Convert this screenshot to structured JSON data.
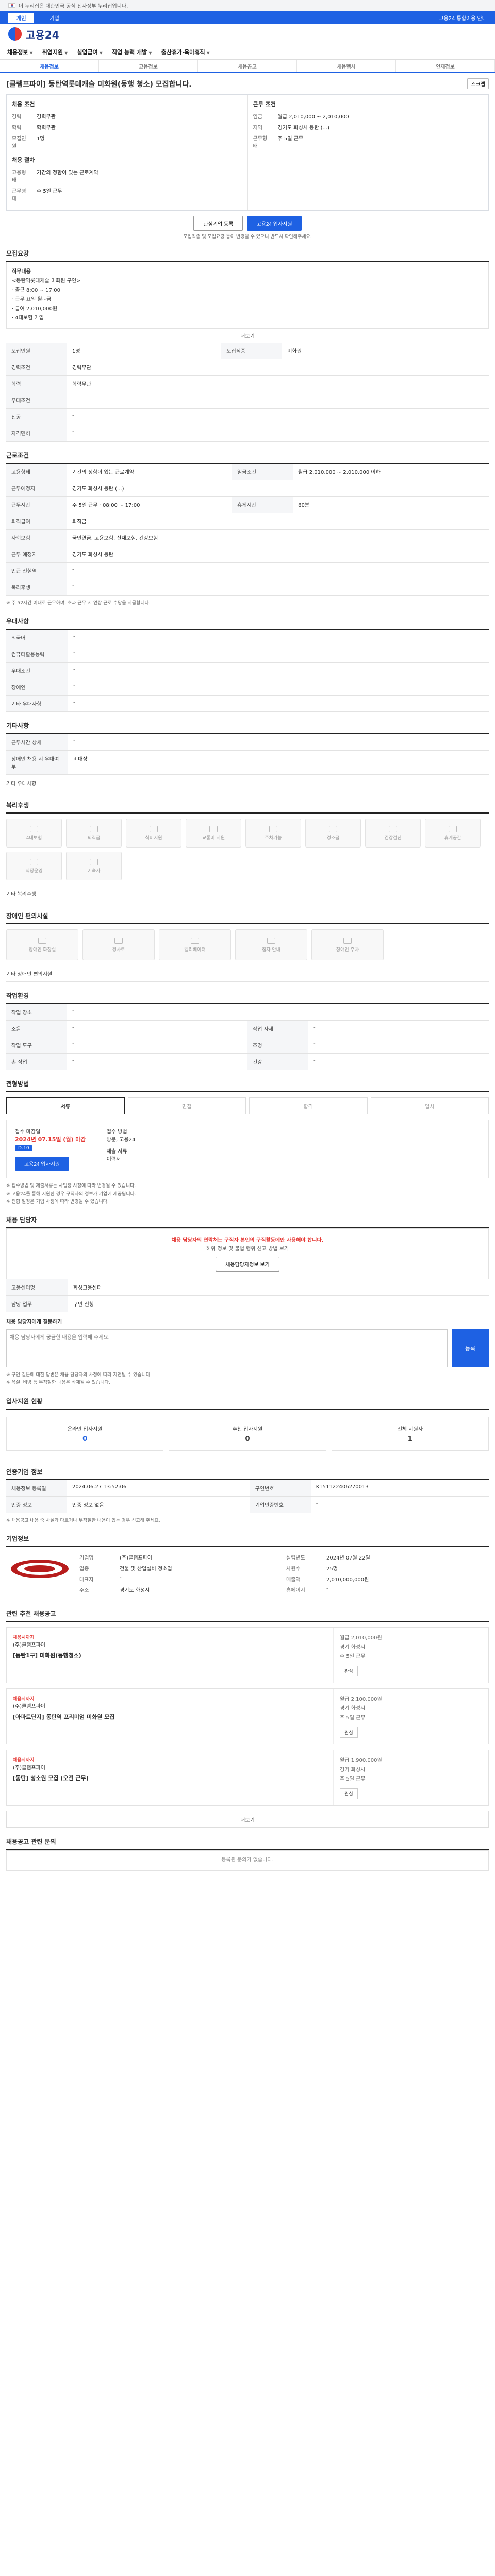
{
  "gov_bar": {
    "text": "이 누리집은 대한민국 공식 전자정부 누리집입니다."
  },
  "util": {
    "tabs": [
      "개인",
      "기업"
    ],
    "right": "고용24 통합이용 안내"
  },
  "logo": {
    "text": "고용24"
  },
  "gnb": {
    "items": [
      "채용정보",
      "취업지원",
      "실업급여",
      "직업 능력 개발",
      "출산휴가·육아휴직"
    ]
  },
  "subtabs": [
    "채용정보",
    "고용정보",
    "채용공고",
    "채용행사",
    "인재정보"
  ],
  "page": {
    "title": "[클램프파이] 동탄역롯데캐슬 미화원(동행 청소) 모집합니다.",
    "scrap": "스크랩"
  },
  "summary": {
    "left_title": "채용 조건",
    "left": [
      [
        "경력",
        "경력무관"
      ],
      [
        "학력",
        "학력무관"
      ],
      [
        "모집인원",
        "1명"
      ]
    ],
    "right_title": "근무 조건",
    "right": [
      [
        "임금",
        "월급 2,010,000 ~ 2,010,000"
      ],
      [
        "지역",
        "경기도 화성시 동탄 (...)"
      ],
      [
        "근무형태",
        "주 5일 근무"
      ]
    ],
    "bottom_title": "채용 절차",
    "bottom": [
      [
        "고용형태",
        "기간의 정함이 있는 근로계약"
      ],
      [
        "근무형태",
        "주 5일 근무"
      ]
    ]
  },
  "buttons": {
    "interest": "관심기업 등록",
    "apply": "고용24 입사지원"
  },
  "apply_note": "모집직종 및 모집요강 등이 변경될 수 있으니 반드시 확인해주세요.",
  "recruit": {
    "title": "모집요강",
    "intro_label": "직무내용",
    "intro_lines": [
      "<동탄역롯데캐슬 미화원 구인>",
      "· 출근 8:00 ~ 17:00",
      "· 근무 요일 월~금",
      "· 급여 2,010,000원",
      "· 4대보험 가입"
    ],
    "more": "더보기",
    "rows": [
      [
        "모집인원",
        "1명",
        "모집직종",
        "미화원"
      ],
      [
        "경력조건",
        "경력무관",
        "",
        " "
      ],
      [
        "학력",
        "학력무관",
        "",
        ""
      ],
      [
        "우대조건",
        "",
        "",
        " "
      ],
      [
        "전공",
        "-",
        "",
        ""
      ],
      [
        "자격면허",
        "-",
        "",
        ""
      ]
    ]
  },
  "conditions": {
    "title": "근로조건",
    "rows": [
      [
        "고용형태",
        "기간의 정함이 있는 근로계약",
        "임금조건",
        "월급 2,010,000 ~ 2,010,000 이하"
      ],
      [
        "근무예정지",
        "경기도 화성시 동탄 (...)",
        "",
        ""
      ],
      [
        "근무시간",
        "주 5일 근무 · 08:00 ~ 17:00",
        "휴게시간",
        "60분"
      ],
      [
        "퇴직급여",
        "퇴직금",
        "",
        ""
      ],
      [
        "사회보험",
        "국민연금, 고용보험, 산재보험, 건강보험",
        "",
        ""
      ],
      [
        "근무 예정지",
        "경기도 화성시 동탄",
        "",
        ""
      ],
      [
        "인근 전철역",
        "-",
        "",
        ""
      ],
      [
        "복리후생",
        "-",
        "",
        ""
      ]
    ],
    "foot": "※ 주 52시간 이내로 근무하며, 초과 근무 시 연장 근로 수당을 지급합니다."
  },
  "welfare": {
    "title": "우대사항",
    "rows": [
      [
        "외국어",
        "-"
      ],
      [
        "컴퓨터활용능력",
        "-"
      ],
      [
        "우대조건",
        "-"
      ],
      [
        "장애인",
        "-"
      ],
      [
        "기타 우대사항",
        "-"
      ]
    ]
  },
  "extra": {
    "title": "기타사항",
    "rows": [
      [
        "근무시간 상세",
        "-"
      ],
      [
        "장애인 채용 시 우대여부",
        "비대상"
      ]
    ],
    "link": "기타 우대사항"
  },
  "benefits": {
    "title": "복리후생",
    "items": [
      "4대보험",
      "퇴직금",
      "식비지원",
      "교통비 지원",
      "주차가능",
      "경조금",
      "건강검진",
      "휴게공간",
      "식당운영",
      "기숙사"
    ],
    "subline": "기타 복리후생"
  },
  "facilities": {
    "title": "장애인 편의시설",
    "items": [
      "장애인 화장실",
      "경사로",
      "엘리베이터",
      "점자 안내",
      "장애인 주차"
    ],
    "subline": "기타 장애인 편의시설"
  },
  "company_env": {
    "title": "작업환경",
    "rows": [
      [
        "작업 장소",
        "-",
        "",
        ""
      ],
      [
        "소음",
        "-",
        "작업 자세",
        "-"
      ],
      [
        "작업 도구",
        "-",
        "조명",
        "-"
      ],
      [
        "손 작업",
        "-",
        "건강",
        "-"
      ]
    ]
  },
  "procedure": {
    "title": "전형방법",
    "tabs": [
      "서류",
      "면접",
      "합격",
      "입사"
    ],
    "apply_label": "접수 마감일",
    "deadline": "2024년 07.15일 (월) 마감",
    "status_tag": "D-10",
    "method_label": "접수 방법",
    "method": "방문, 고용24",
    "doc_label": "제출 서류",
    "doc": "이력서",
    "btn": "고용24 입사지원",
    "notes": [
      "※ 접수방법 및 제출서류는 사업장 사정에 따라 변경될 수 있습니다.",
      "※ 고용24를 통해 지원한 경우 구직자의 정보가 기업에 제공됩니다.",
      "※ 전형 일정은 기업 사정에 따라 변경될 수 있습니다."
    ]
  },
  "contact": {
    "title": "채용 담당자",
    "warn": "채용 담당자의 연락처는 구직자 본인의 구직활동에만 사용해야 합니다.",
    "sub": "허위 정보 및 불법 행위 신고 방법 보기",
    "view": "채용담당자정보 보기",
    "rows": [
      [
        "고용센터명",
        "화성고용센터",
        "",
        ""
      ],
      [
        "담당 업무",
        "구인 신청",
        "",
        ""
      ]
    ],
    "qa_label": "채용 담당자에게 질문하기",
    "qa_placeholder": "채용 담당자에게 궁금한 내용을 입력해 주세요.",
    "qa_btn": "등록",
    "qa_notes": [
      "※ 구인 질문에 대한 답변은 채용 담당자의 사정에 따라 지연될 수 있습니다.",
      "※ 욕설, 비방 등 부적절한 내용은 삭제될 수 있습니다."
    ]
  },
  "stats": {
    "title": "입사지원 현황",
    "items": [
      [
        "온라인 입사지원",
        "0"
      ],
      [
        "추천 입사지원",
        "0"
      ],
      [
        "전체 지원자",
        "1"
      ]
    ]
  },
  "registration": {
    "title": "인증기업 정보",
    "rows": [
      [
        "채용정보 등록일",
        "2024.06.27 13:52:06",
        "구인번호",
        "K151122406270013"
      ],
      [
        "인증 정보",
        "인증 정보 없음",
        "기업인증번호",
        "-"
      ]
    ],
    "notes": [
      "※ 채용공고 내용 중 사실과 다르거나 부적절한 내용이 있는 경우 신고해 주세요."
    ]
  },
  "company": {
    "title": "기업정보",
    "name": "클램프파이",
    "rows": [
      [
        "기업명",
        "(주)클램프파이",
        "설립년도",
        "2024년 07월 22일"
      ],
      [
        "업종",
        "건물 및 산업설비 청소업",
        "사원수",
        "25명"
      ],
      [
        "대표자",
        "-",
        "매출액",
        "2,010,000,000원"
      ],
      [
        "주소",
        "경기도 화성시",
        "홈페이지",
        "-"
      ]
    ]
  },
  "related": {
    "title": "관련 추천 채용공고",
    "cards": [
      {
        "badge": "채용시까지",
        "company": "(주)클램프파이",
        "title": "[동탄1구] 미화원(동행청소)",
        "meta": [
          "월급 2,010,000원",
          "경기 화성시",
          "주 5일 근무"
        ],
        "save": "관심"
      },
      {
        "badge": "채용시까지",
        "company": "(주)클램프파이",
        "title": "[아파트단지] 동탄역 프리미엄 미화원 모집",
        "meta": [
          "월급 2,100,000원",
          "경기 화성시",
          "주 5일 근무"
        ],
        "save": "관심"
      },
      {
        "badge": "채용시까지",
        "company": "(주)클램프파이",
        "title": "[동탄] 청소원 모집 (오전 근무)",
        "meta": [
          "월급 1,900,000원",
          "경기 화성시",
          "주 5일 근무"
        ],
        "save": "관심"
      }
    ],
    "more": "더보기"
  },
  "comments": {
    "title": "채용공고 관련 문의",
    "empty": "등록된 문의가 없습니다."
  }
}
